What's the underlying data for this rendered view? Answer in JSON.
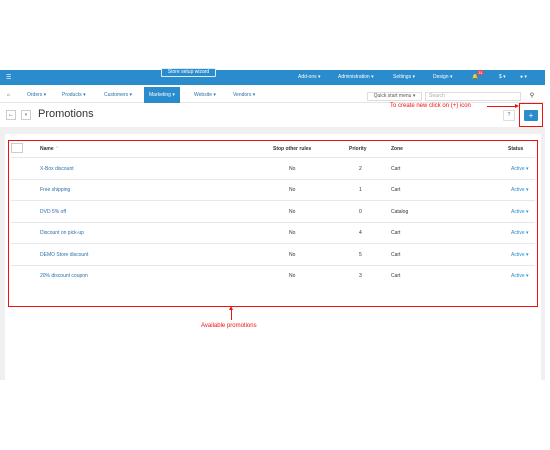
{
  "topbar": {
    "wizard_label": "Store setup wizard",
    "menu": [
      {
        "label": "Add-ons ▾"
      },
      {
        "label": "Administration ▾"
      },
      {
        "label": "Settings ▾"
      },
      {
        "label": "Design ▾"
      }
    ],
    "notifications_count": "31",
    "currency_label": "$ ▾",
    "user_label": "▾"
  },
  "nav": {
    "items": [
      {
        "label": "Orders ▾"
      },
      {
        "label": "Products ▾"
      },
      {
        "label": "Customers ▾"
      },
      {
        "label": "Marketing ▾"
      },
      {
        "label": "Website ▾"
      },
      {
        "label": "Vendors ▾"
      }
    ],
    "active": "Marketing",
    "quickstart_label": "Quick start menu ▾",
    "search_placeholder": "Search"
  },
  "page": {
    "title": "Promotions",
    "back_label": "←",
    "dropdown_label": "▾",
    "help_label": "❓",
    "add_label": "+"
  },
  "annotations": {
    "add_hint": "To create new click on (+) icon",
    "available_label": "Available promotions",
    "color": "#e11111"
  },
  "table": {
    "headers": {
      "name": "Name",
      "sort_icon": "⌃",
      "stop": "Stop other rules",
      "priority": "Priority",
      "zone": "Zone",
      "status": "Status"
    },
    "rows": [
      {
        "name": "X-Box discount",
        "stop": "No",
        "priority": "2",
        "zone": "Cart",
        "status": "Active ▾"
      },
      {
        "name": "Free shipping",
        "stop": "No",
        "priority": "1",
        "zone": "Cart",
        "status": "Active ▾"
      },
      {
        "name": "DVD 5% off",
        "stop": "No",
        "priority": "0",
        "zone": "Catalog",
        "status": "Active ▾"
      },
      {
        "name": "Discount on pick-up",
        "stop": "No",
        "priority": "4",
        "zone": "Cart",
        "status": "Active ▾"
      },
      {
        "name": "DEMO Store discount",
        "stop": "No",
        "priority": "5",
        "zone": "Cart",
        "status": "Active ▾"
      },
      {
        "name": "20% discount coupon",
        "stop": "No",
        "priority": "3",
        "zone": "Cart",
        "status": "Active ▾"
      }
    ]
  },
  "colors": {
    "brand_blue": "#2a8bcd",
    "link_blue": "#2a6fa8"
  }
}
